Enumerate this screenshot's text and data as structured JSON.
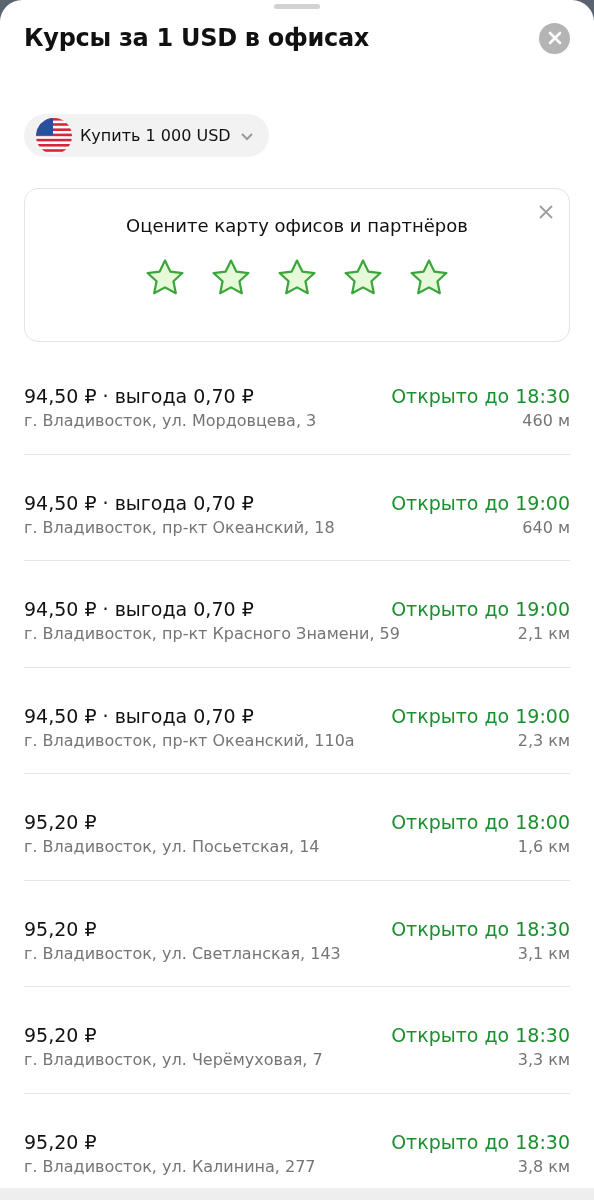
{
  "title": "Курсы за 1 USD в офисах",
  "chip": {
    "label": "Купить 1 000 USD"
  },
  "rating": {
    "prompt": "Оцените карту офисов и партнёров",
    "stars": 5
  },
  "offices": [
    {
      "price": "94,50 ₽",
      "separator": "·",
      "benefit": "выгода 0,70 ₽",
      "status": "Открыто до 18:30",
      "address": "г. Владивосток, ул. Мордовцева, 3",
      "distance": "460 м"
    },
    {
      "price": "94,50 ₽",
      "separator": "·",
      "benefit": "выгода 0,70 ₽",
      "status": "Открыто до 19:00",
      "address": "г. Владивосток, пр-кт Океанский, 18",
      "distance": "640 м"
    },
    {
      "price": "94,50 ₽",
      "separator": "·",
      "benefit": "выгода 0,70 ₽",
      "status": "Открыто до 19:00",
      "address": "г. Владивосток, пр-кт Красного Знамени, 59",
      "distance": "2,1 км"
    },
    {
      "price": "94,50 ₽",
      "separator": "·",
      "benefit": "выгода 0,70 ₽",
      "status": "Открыто до 19:00",
      "address": "г. Владивосток, пр-кт Океанский, 110а",
      "distance": "2,3 км"
    },
    {
      "price": "95,20 ₽",
      "status": "Открыто до 18:00",
      "address": "г. Владивосток, ул. Посьетская, 14",
      "distance": "1,6 км"
    },
    {
      "price": "95,20 ₽",
      "status": "Открыто до 18:30",
      "address": "г. Владивосток, ул. Светланская, 143",
      "distance": "3,1 км"
    },
    {
      "price": "95,20 ₽",
      "status": "Открыто до 18:30",
      "address": "г. Владивосток, ул. Черёмуховая, 7",
      "distance": "3,3 км"
    },
    {
      "price": "95,20 ₽",
      "status": "Открыто до 18:30",
      "address": "г. Владивосток, ул. Калинина, 277",
      "distance": "3,8 км"
    }
  ]
}
